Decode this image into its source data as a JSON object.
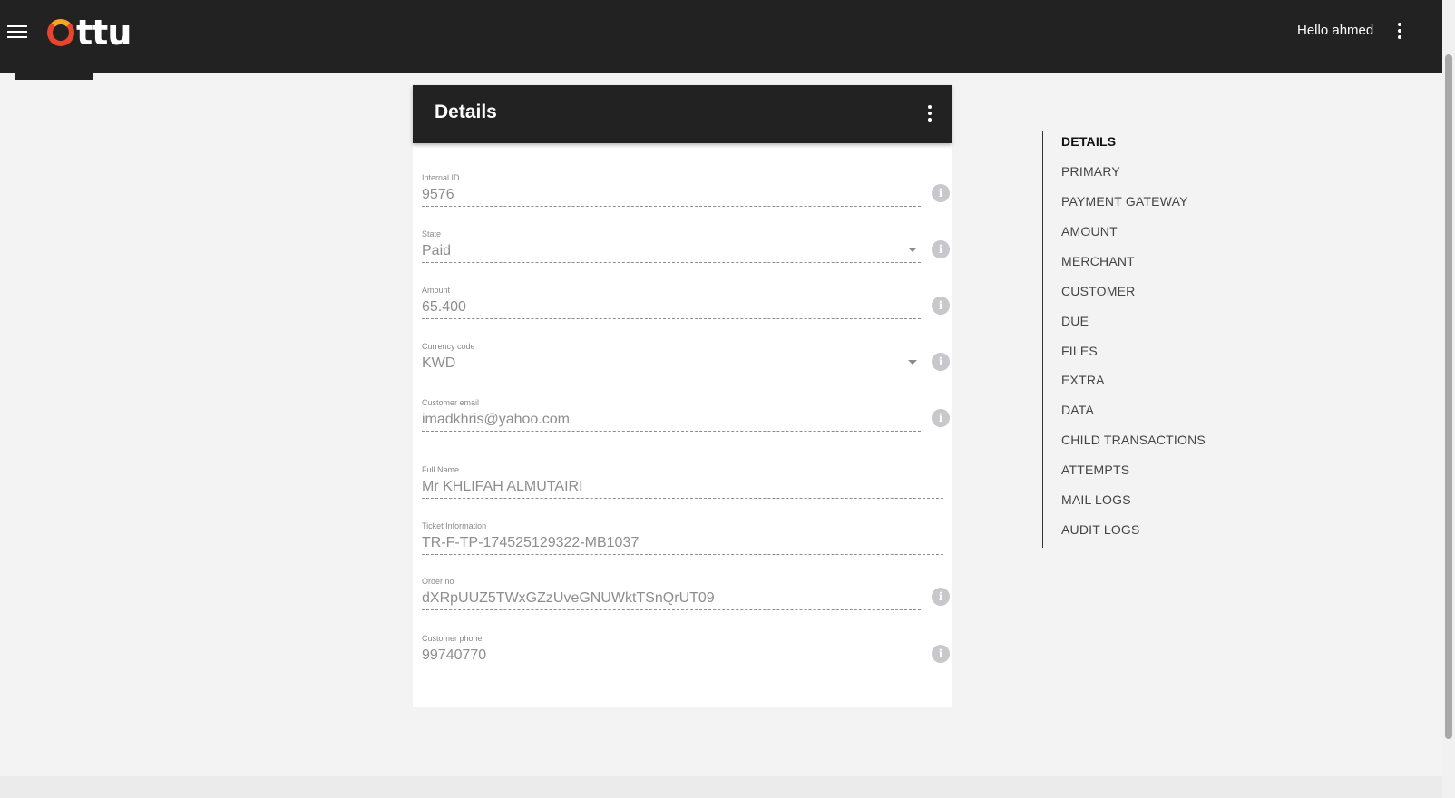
{
  "header": {
    "logo_text": "ttu",
    "greeting": "Hello ahmed"
  },
  "card": {
    "title": "Details",
    "fields": [
      {
        "label": "Internal ID",
        "value": "9576"
      },
      {
        "label": "State",
        "value": "Paid"
      },
      {
        "label": "Amount",
        "value": "65.400"
      },
      {
        "label": "Currency code",
        "value": "KWD"
      },
      {
        "label": "Customer email",
        "value": "imadkhris@yahoo.com"
      },
      {
        "label": "Full Name",
        "value": "Mr KHLIFAH ALMUTAIRI"
      },
      {
        "label": "Ticket Information",
        "value": "TR-F-TP-174525129322-MB1037"
      },
      {
        "label": "Order no",
        "value": "dXRpUUZ5TWxGZzUveGNUWktTSnQrUT09"
      },
      {
        "label": "Customer phone",
        "value": "99740770"
      }
    ]
  },
  "nav": {
    "items": [
      {
        "label": "DETAILS"
      },
      {
        "label": "PRIMARY"
      },
      {
        "label": "PAYMENT GATEWAY"
      },
      {
        "label": "AMOUNT"
      },
      {
        "label": "MERCHANT"
      },
      {
        "label": "CUSTOMER"
      },
      {
        "label": "DUE"
      },
      {
        "label": "FILES"
      },
      {
        "label": "EXTRA"
      },
      {
        "label": "DATA"
      },
      {
        "label": "CHILD TRANSACTIONS"
      },
      {
        "label": "ATTEMPTS"
      },
      {
        "label": "MAIL LOGS"
      },
      {
        "label": "AUDIT LOGS"
      }
    ]
  },
  "icons": {
    "menu": "hamburger-icon",
    "more": "more-vert-icon",
    "info": "info-icon",
    "dropdown": "arrow-drop-down-icon"
  },
  "colors": {
    "header_bg": "#222222",
    "page_bg": "#f3f3f3",
    "logo_orange": "#e8452c",
    "logo_yellow": "#f6a623"
  }
}
